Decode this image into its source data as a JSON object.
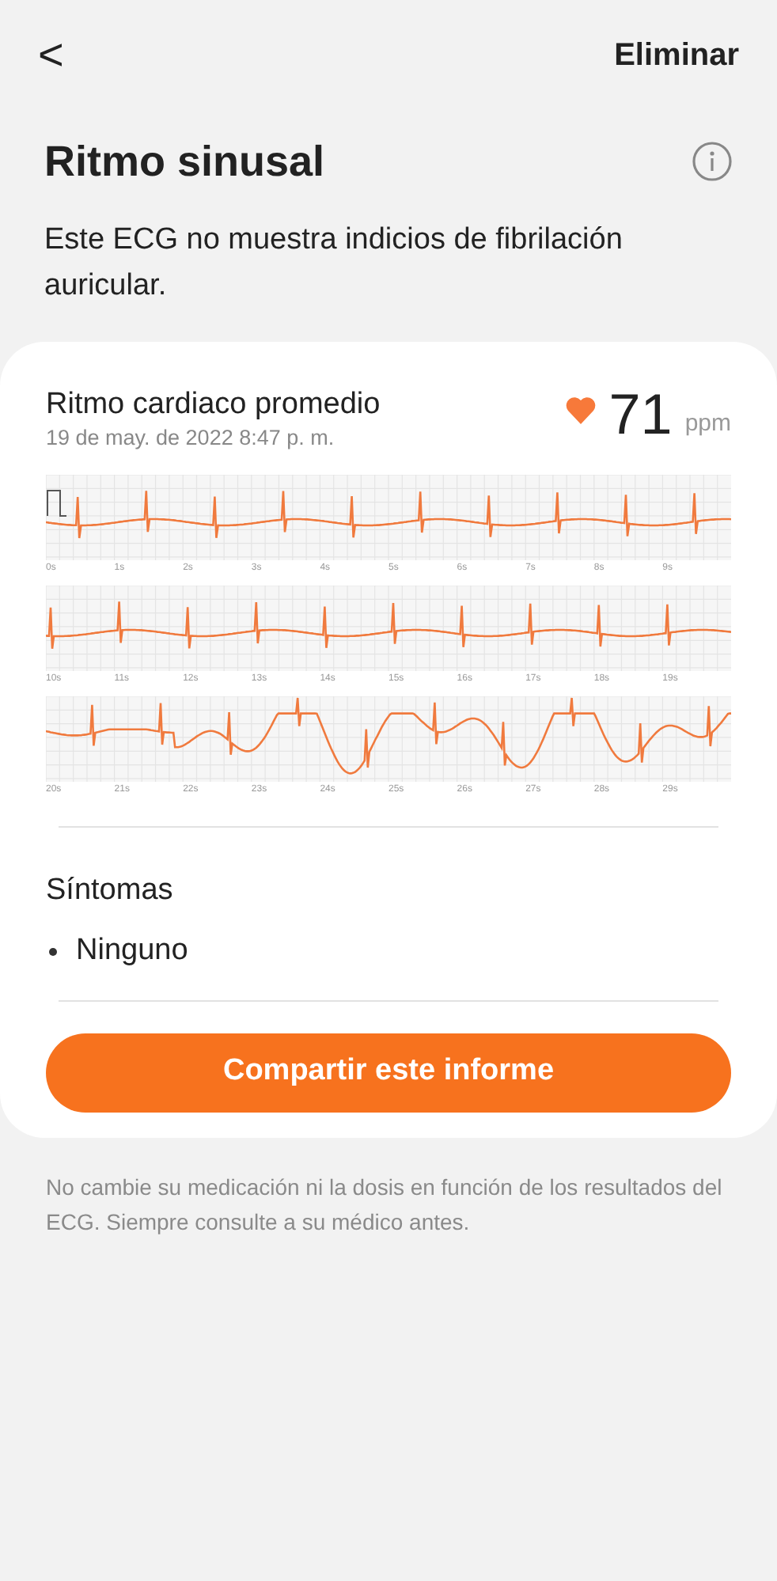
{
  "header": {
    "back": "<",
    "action": "Eliminar"
  },
  "result": {
    "title": "Ritmo sinusal",
    "description": "Este ECG no muestra indicios de fibrilación auricular."
  },
  "card": {
    "heart_rate_label": "Ritmo cardiaco promedio",
    "timestamp": "19 de may. de 2022 8:47 p. m.",
    "heart_rate": "71",
    "unit": "ppm",
    "strips": [
      {
        "ticks": [
          "0s",
          "1s",
          "2s",
          "3s",
          "4s",
          "5s",
          "6s",
          "7s",
          "8s",
          "9s"
        ]
      },
      {
        "ticks": [
          "10s",
          "11s",
          "12s",
          "13s",
          "14s",
          "15s",
          "16s",
          "17s",
          "18s",
          "19s"
        ]
      },
      {
        "ticks": [
          "20s",
          "21s",
          "22s",
          "23s",
          "24s",
          "25s",
          "26s",
          "27s",
          "28s",
          "29s"
        ]
      }
    ],
    "symptoms_title": "Síntomas",
    "symptoms": [
      "Ninguno"
    ],
    "share_button": "Compartir este informe"
  },
  "disclaimer": "No cambie su medicación ni la dosis en función de los resultados del ECG. Siempre consulte a su médico antes."
}
